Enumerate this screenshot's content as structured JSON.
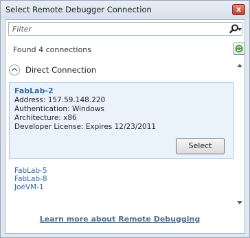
{
  "window": {
    "title": "Select Remote Debugger Connection",
    "close_label": "x"
  },
  "filter": {
    "placeholder": "Filter"
  },
  "status": {
    "found_text": "Found 4 connections"
  },
  "group": {
    "label": "Direct Connection",
    "selected": {
      "name": "FabLab-2",
      "details": [
        "Address: 157.59.148.220",
        "Authentication: Windows",
        "Architecture: x86",
        "Developer License: Expires 12/23/2011"
      ],
      "select_label": "Select"
    },
    "others": [
      "FabLab-5",
      "FabLab-8",
      "JoeVM-1"
    ]
  },
  "footer": {
    "link_label": "Learn more about Remote Debugging"
  },
  "colors": {
    "link": "#2f6aa2",
    "card_bg": "#eaf2fc",
    "close": "#c73c25"
  }
}
